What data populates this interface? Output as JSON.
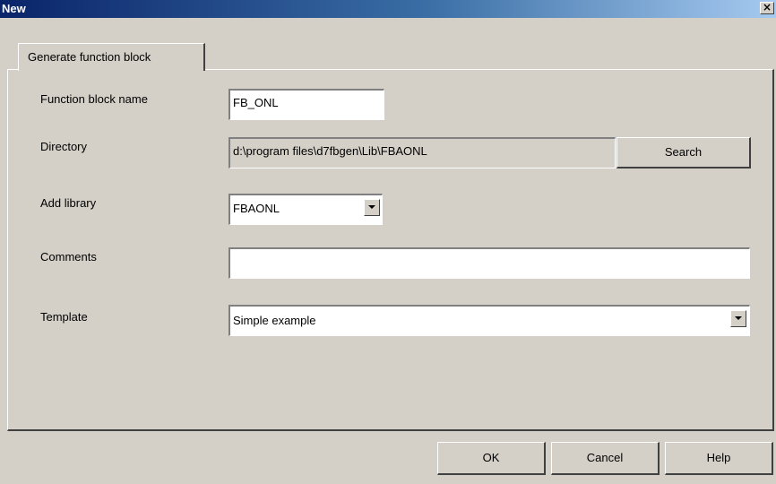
{
  "window": {
    "title": "New",
    "close_glyph": "×"
  },
  "tabs": [
    {
      "label": "Generate function block"
    }
  ],
  "form": {
    "function_block_name": {
      "label": "Function block name",
      "value": "FB_ONL"
    },
    "directory": {
      "label": "Directory",
      "value": "d:\\program files\\d7fbgen\\Lib\\FBAONL",
      "search_label": "Search"
    },
    "add_library": {
      "label": "Add library",
      "selected": "FBAONL"
    },
    "comments": {
      "label": "Comments",
      "value": ""
    },
    "template": {
      "label": "Template",
      "selected": "Simple example"
    }
  },
  "buttons": {
    "ok": "OK",
    "cancel": "Cancel",
    "help": "Help"
  },
  "icons": {
    "close": "close-icon",
    "dropdown": "chevron-down-icon"
  },
  "colors": {
    "titlebar_start": "#0a246a",
    "titlebar_end": "#a6caf0",
    "face": "#d4d0c8"
  }
}
